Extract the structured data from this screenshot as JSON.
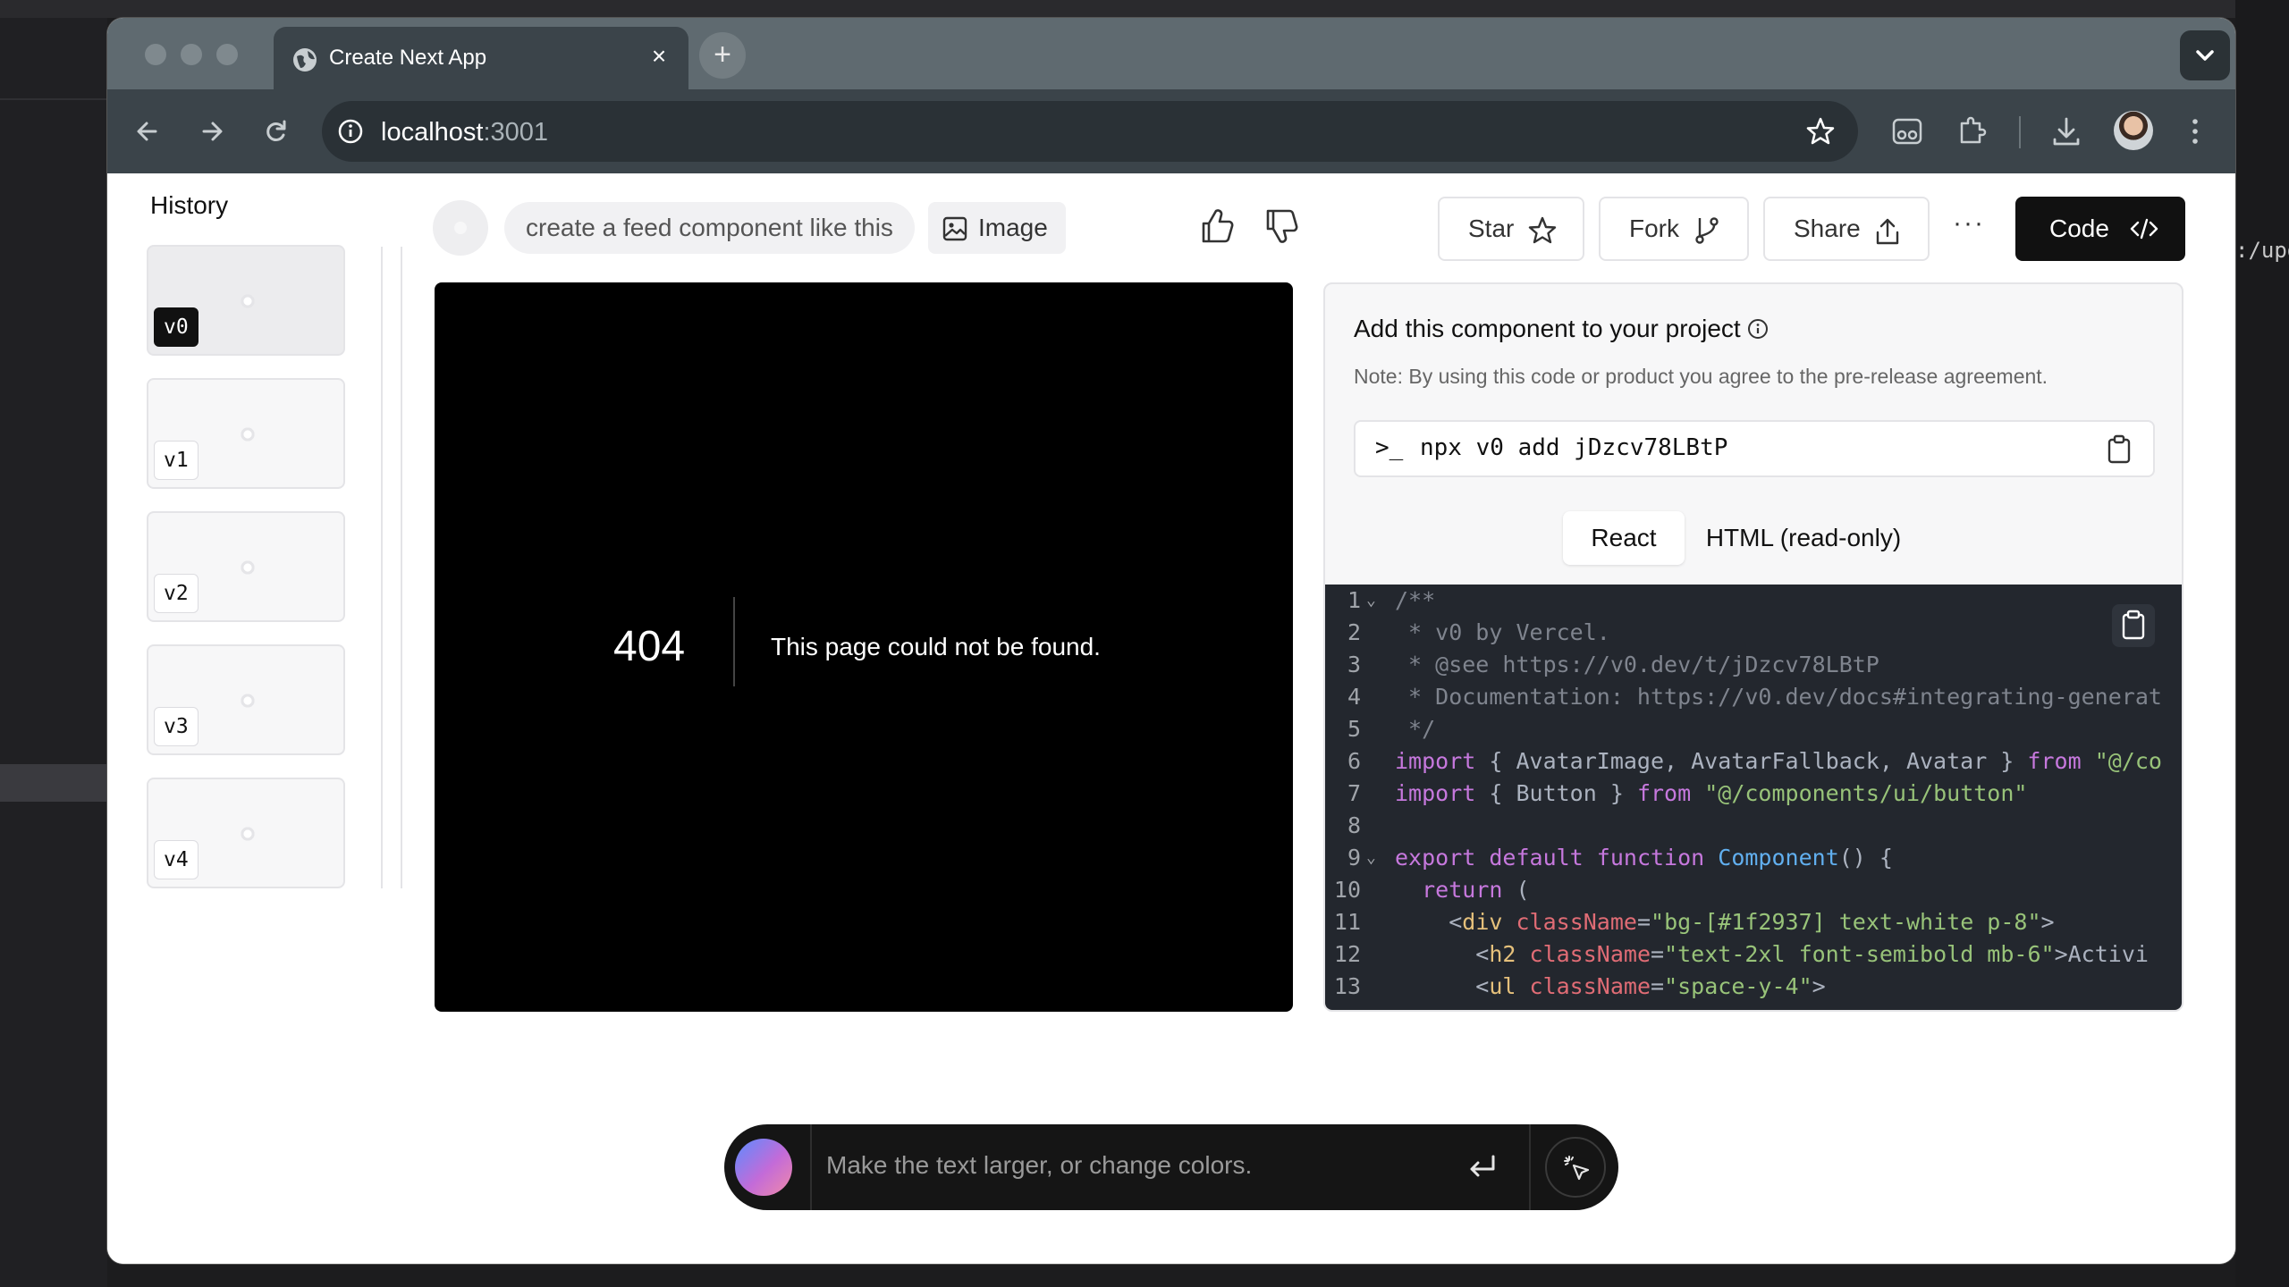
{
  "browser": {
    "tab_title": "Create Next App",
    "url_host": "localhost",
    "url_port": ":3001",
    "new_tab_label": "+",
    "close_tab_label": "×"
  },
  "history": {
    "title": "History",
    "versions": [
      {
        "label": "v0",
        "active": true
      },
      {
        "label": "v1",
        "active": false
      },
      {
        "label": "v2",
        "active": false
      },
      {
        "label": "v3",
        "active": false
      },
      {
        "label": "v4",
        "active": false
      }
    ]
  },
  "prompt": {
    "text": "create a feed component like this",
    "image_chip": "Image"
  },
  "actions": {
    "star": "Star",
    "fork": "Fork",
    "share": "Share",
    "more": "···",
    "code": "Code"
  },
  "preview": {
    "error_code": "404",
    "error_message": "This page could not be found."
  },
  "code_panel": {
    "title": "Add this component to your project",
    "note": "Note: By using this code or product you agree to the pre-release agreement.",
    "command_prompt": ">_",
    "command": "npx v0 add jDzcv78LBtP",
    "tabs": [
      "React",
      "HTML (read-only)"
    ],
    "selected_tab": "React"
  },
  "code_lines": [
    "/**",
    " * v0 by Vercel.",
    " * @see https://v0.dev/t/jDzcv78LBtP",
    " * Documentation: https://v0.dev/docs#integrating-generat",
    " */",
    "import { AvatarImage, AvatarFallback, Avatar } from \"@/co",
    "import { Button } from \"@/components/ui/button\"",
    "",
    "export default function Component() {",
    "  return (",
    "    <div className=\"bg-[#1f2937] text-white p-8\">",
    "      <h2 className=\"text-2xl font-semibold mb-6\">Activi",
    "      <ul className=\"space-y-4\">"
  ],
  "chat": {
    "placeholder": "Make the text larger, or change colors."
  },
  "background": {
    "right_edge_text": ":/upd"
  },
  "colors": {
    "tabstrip": "#5f6a70",
    "toolbar": "#3b444a",
    "code_button": "#111111",
    "editor_bg": "#23272e",
    "preview_bg": "#000000"
  }
}
